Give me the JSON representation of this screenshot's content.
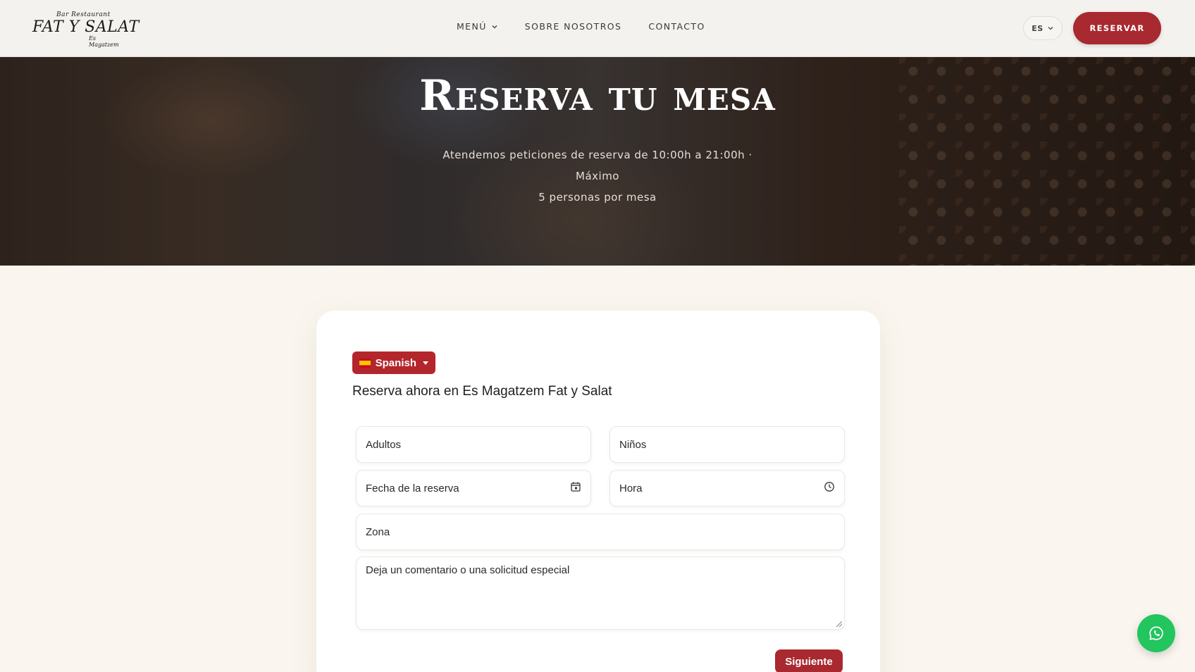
{
  "header": {
    "logo": {
      "line_top": "Bar Restaurant",
      "line_main": "FAT Y SALAT",
      "line_bottom": "Es Magatzem"
    },
    "nav": [
      {
        "label": "MENÚ",
        "has_dropdown": true
      },
      {
        "label": "SOBRE NOSOTROS"
      },
      {
        "label": "CONTACTO"
      }
    ],
    "language": "ES",
    "reserve_label": "RESERVAR"
  },
  "hero": {
    "title": "Reserva tu mesa",
    "subtitle_line1": "Atendemos peticiones de reserva de 10:00h a 21:00h · Máximo",
    "subtitle_line2": "5 personas por mesa"
  },
  "form": {
    "language_select": "Spanish",
    "heading": "Reserva ahora en Es Magatzem Fat y Salat",
    "fields": {
      "adults": "Adultos",
      "children": "Niños",
      "date": "Fecha de la reserva",
      "time": "Hora",
      "zone": "Zona",
      "comment": "Deja un comentario o una solicitud especial"
    },
    "next_label": "Siguiente"
  },
  "colors": {
    "accent": "#a8292f",
    "background": "#faf6ef",
    "whatsapp": "#22c55e"
  },
  "icons": [
    "chevron-down-icon",
    "calendar-icon",
    "clock-icon",
    "whatsapp-icon",
    "spain-flag-icon"
  ]
}
